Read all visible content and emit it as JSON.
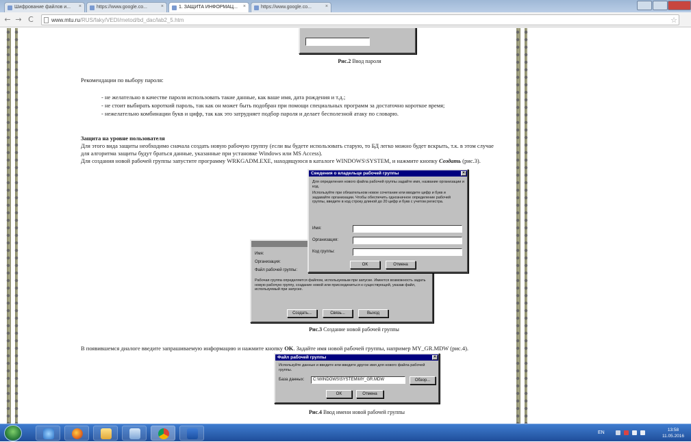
{
  "browser": {
    "tabs": [
      {
        "label": "Шифрование файлов и..."
      },
      {
        "label": "https://www.google.co..."
      },
      {
        "label": "1. ЗАЩИТА ИНФОРМАЦ..."
      },
      {
        "label": "https://www.google.co..."
      }
    ],
    "url_host": "www.mtu.ru",
    "url_path": "/RUS/faky/VEDI/metod/bd_dac/lab2_5.htm"
  },
  "article": {
    "fig2_caption_num": "Рис.2",
    "fig2_caption_text": "Ввод пароля",
    "recommend_heading": "Рекомендации по выбору пароля:",
    "bullets": [
      "- не желательно в качестве пароля использовать такие данные, как ваше имя, дата рождения и т.д.;",
      "- не стоит выбирать короткий пароль, так как он может быть подобран при помощи специальных программ за достаточно короткое время;",
      "- нежелательно комбинации букв и цифр, так как это затрудняет подбор пароля и делает бесполезной атаку по словарю."
    ],
    "user_level_heading": "Защита на уровне пользователя",
    "user_level_p1": "Для этого вида защиты необходимо сначала создать новую рабочую группу (если вы будете использовать старую, то БД легко можно будет вскрыть, т.к. в этом случае",
    "user_level_p2": "для алгоритма защиты будут браться данные, указанные при установке Windows или MS Access).",
    "user_level_p3_a": "Для создания новой рабочей группы запустите программу WRKGADM.EXE, находящуюся в каталоге WINDOWS\\SYSTEM, и нажмите кнопку",
    "user_level_p3_b": "Создать",
    "user_level_p3_c": "(рис.3).",
    "fig3_caption_num": "Рис.3",
    "fig3_caption_text": "Создание новой рабочей группы",
    "after_fig3_a": "В появившемся диалоге введите запрашиваемую информацию и нажмите кнопку",
    "after_fig3_ok": "OK",
    "after_fig3_b": ". Задайте имя новой рабочей группы, например MY_GR.MDW (рис.4).",
    "fig4_caption_num": "Рис.4",
    "fig4_caption_text": "Ввод имени новой рабочей группы"
  },
  "dialog_owner": {
    "title": "Сведения о владельце рабочей группы",
    "intro1": "Для определения нового файла рабочей группы задайте имя, название организации и код.",
    "intro2": "Используйте при обязательном новое сочетание или вводите цифр и букв и задавайте организации. Чтобы обеспечить однозначное определение рабочей группы, введите в код строку длиной до 20 цифр и букв с учетом регистра.",
    "name_label": "Имя:",
    "org_label": "Организация:",
    "code_label": "Код группы:",
    "ok": "OK",
    "cancel": "Отмена"
  },
  "dialog_admin": {
    "name_label": "Имя:",
    "org_label": "Организация:",
    "file_label": "Файл рабочей группы:",
    "para": "Рабочая группа определяется файлом, используемым при запуске. Имеется возможность задать новую рабочую группу, создание новой или присоединиться к существующей, указав файл, используемый при запуске.",
    "create": "Создать...",
    "join": "Связь...",
    "exit": "Выход"
  },
  "dialog_file": {
    "title": "Файл рабочей группы",
    "para": "Используйте данные и введите или введите другое имя для нового файла рабочей группы.",
    "db_label": "База данных:",
    "db_value": "C:\\WINDOWS\\SYSTEM\\MY_GR.MDW",
    "browse": "Обзор...",
    "ok": "OK",
    "cancel": "Отмена"
  },
  "taskbar": {
    "lang": "EN",
    "time": "13:58",
    "date": "11.05.2016"
  },
  "colors": {
    "title_bar": "#00007f",
    "dialog_face": "#c0c0c0",
    "taskbar": "#1f4e9a"
  }
}
